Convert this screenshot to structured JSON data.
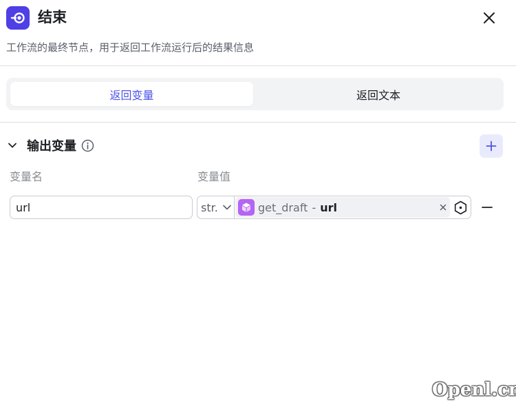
{
  "header": {
    "title": "结束",
    "description": "工作流的最终节点，用于返回工作流运行后的结果信息",
    "app_icon": "end-node-icon",
    "close_icon": "close-icon"
  },
  "tabs": [
    {
      "label": "返回变量",
      "active": true
    },
    {
      "label": "返回文本",
      "active": false
    }
  ],
  "output_section": {
    "title": "输出变量",
    "columns": {
      "name": "变量名",
      "value": "变量值"
    },
    "rows": [
      {
        "name": "url",
        "type": "str.",
        "ref_node": "get_draft",
        "ref_separator": "-",
        "ref_var": "url"
      }
    ]
  },
  "watermark": "Openl.cn",
  "colors": {
    "accent": "#4d53e8",
    "app_icon_bg": "#4e40e5",
    "node_icon_bg": "#b564f3",
    "add_button_bg": "#e9ebfd"
  }
}
